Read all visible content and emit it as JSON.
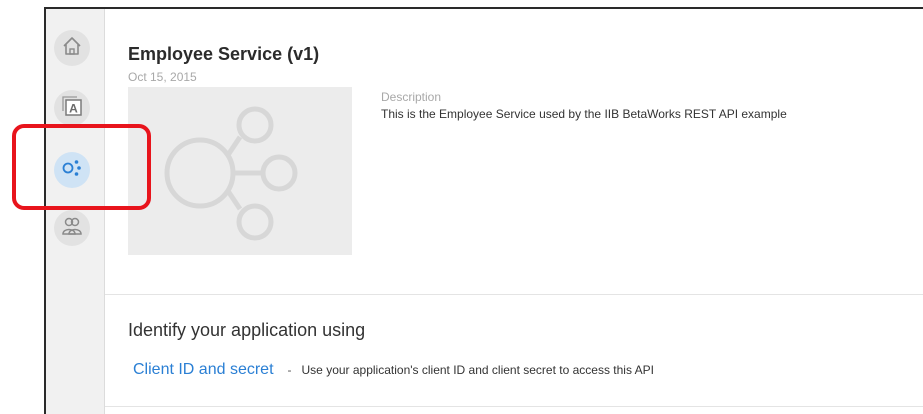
{
  "colors": {
    "accent": "#2a7fd4",
    "highlight": "#e8141c",
    "rail_bg": "#f1f1f1",
    "active_icon": "#2a7fd4"
  },
  "rail": {
    "items": [
      {
        "icon": "home-icon",
        "label": ""
      },
      {
        "icon": "catalog-icon",
        "label": "A"
      },
      {
        "icon": "api-network-icon",
        "label": "",
        "active": true
      },
      {
        "icon": "users-icon",
        "label": ""
      }
    ]
  },
  "api": {
    "title": "Employee Service (v1)",
    "date": "Oct 15, 2015",
    "description_label": "Description",
    "description": "This is the Employee Service used by the IIB BetaWorks REST API example"
  },
  "identify": {
    "heading": "Identify your application using",
    "method_link": "Client ID and secret",
    "separator": "-",
    "method_desc": "Use your application's client ID and client secret to access this API"
  }
}
